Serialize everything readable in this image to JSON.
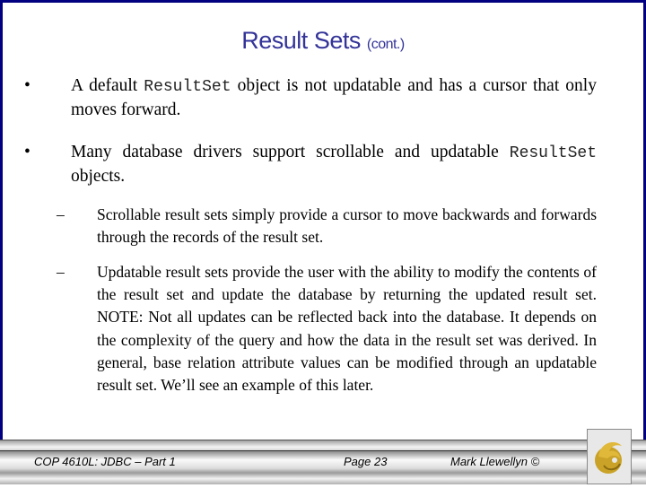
{
  "slide": {
    "title": "Result Sets",
    "title_suffix": "(cont.)",
    "bullets": [
      {
        "marker": "•",
        "text_pre": "A default ",
        "code": "ResultSet",
        "text_post": " object is not updatable and has a cursor that only moves forward."
      },
      {
        "marker": "•",
        "text_pre": "Many database drivers support scrollable and updatable ",
        "code": "ResultSet",
        "text_post": " objects."
      }
    ],
    "sub_items": [
      {
        "marker": "–",
        "text": "Scrollable result sets simply provide a cursor to move backwards and forwards through the records of the result set."
      },
      {
        "marker": "–",
        "text": "Updatable result sets provide the user with the ability to modify the contents of the result set and update the database by returning the updated result set.  NOTE: Not all updates can be reflected back into the database.  It depends on the complexity of the query and how the data in the result set was derived.  In general, base relation attribute values can be modified through an updatable result set.  We’ll see an example of this later."
      }
    ]
  },
  "footer": {
    "course": "COP 4610L: JDBC – Part 1",
    "page": "Page 23",
    "author": "Mark Llewellyn ©",
    "logo_icon": "ucf-pegasus-logo-icon"
  },
  "colors": {
    "frame": "#000080",
    "title": "#333399",
    "logo_gold": "#c9a227"
  }
}
